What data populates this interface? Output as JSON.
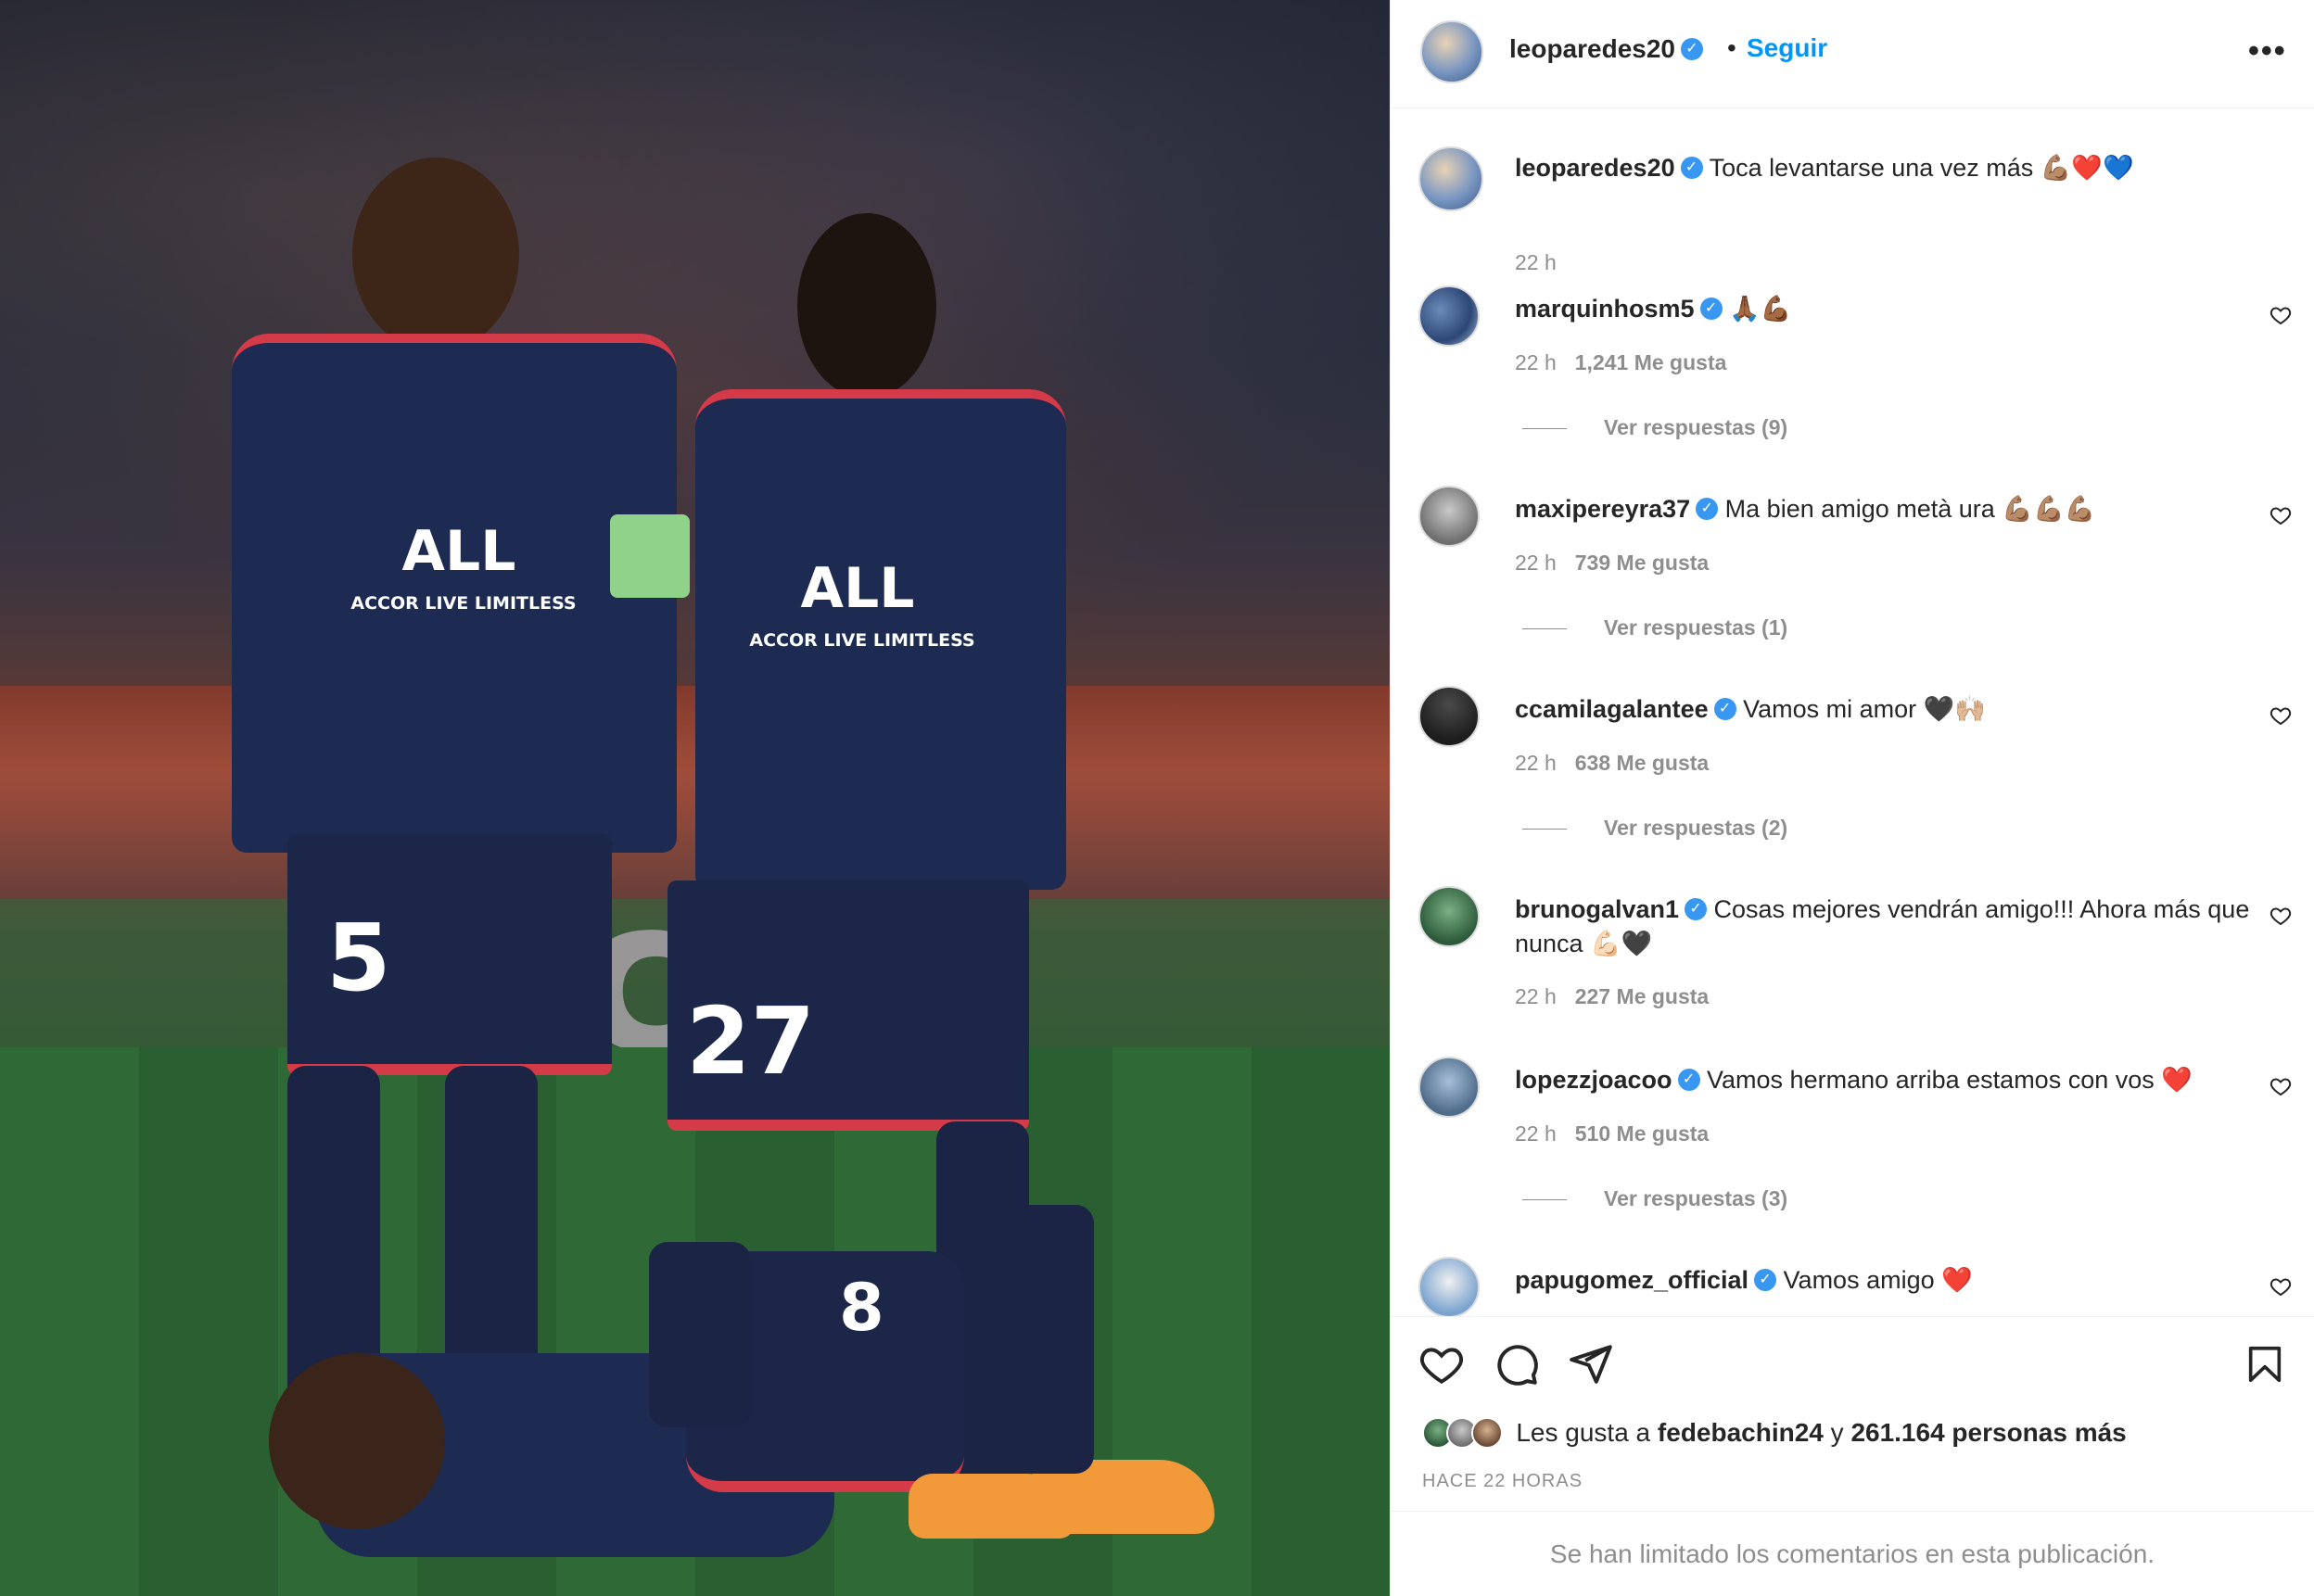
{
  "post": {
    "author": "leoparedes20",
    "follow_label": "Seguir",
    "separator": "•",
    "more_label": "•••",
    "verified_mark": "✓"
  },
  "photo": {
    "board_text": "can",
    "jersey_sponsor_line1": "ALL",
    "jersey_sponsor_line2": "ACCOR LIVE LIMITLESS",
    "player_numbers": [
      "5",
      "27",
      "8"
    ]
  },
  "caption": {
    "username": "leoparedes20",
    "text": "Toca levantarse una vez más 💪🏽❤️💙",
    "time": "22 h"
  },
  "comments": [
    {
      "username": "marquinhosm5",
      "text": "🙏🏾💪🏾",
      "time": "22 h",
      "likes": "1,241 Me gusta",
      "replies": "Ver respuestas (9)"
    },
    {
      "username": "maxipereyra37",
      "text": "Ma bien amigo metà ura 💪🏽💪🏽💪🏽",
      "time": "22 h",
      "likes": "739 Me gusta",
      "replies": "Ver respuestas (1)"
    },
    {
      "username": "ccamilagalantee",
      "text": "Vamos mi amor 🖤🙌🏼",
      "time": "22 h",
      "likes": "638 Me gusta",
      "replies": "Ver respuestas (2)"
    },
    {
      "username": "brunogalvan1",
      "text": "Cosas mejores vendrán amigo!!! Ahora más que nunca 💪🏻🖤",
      "time": "22 h",
      "likes": "227 Me gusta",
      "replies": ""
    },
    {
      "username": "lopezzjoacoo",
      "text": "Vamos hermano arriba estamos con vos ❤️",
      "time": "22 h",
      "likes": "510 Me gusta",
      "replies": "Ver respuestas (3)"
    },
    {
      "username": "papugomez_official",
      "text": "Vamos amigo ❤️",
      "time": "",
      "likes": "",
      "replies": ""
    }
  ],
  "actions": {
    "likes_prefix": "Les gusta a",
    "liked_by": "fedebachin24",
    "likes_join": "y",
    "likes_count": "261.164 personas más",
    "timestamp": "HACE 22 HORAS"
  },
  "footer": {
    "limited_text": "Se han limitado los comentarios en esta publicación."
  },
  "colors": {
    "accent_blue": "#0095f6",
    "verified_blue": "#3897f0",
    "text_primary": "#262626",
    "text_secondary": "#8e8e8e"
  },
  "icons": [
    "heart-icon",
    "comment-icon",
    "share-icon",
    "bookmark-icon",
    "more-icon",
    "verified-icon"
  ]
}
